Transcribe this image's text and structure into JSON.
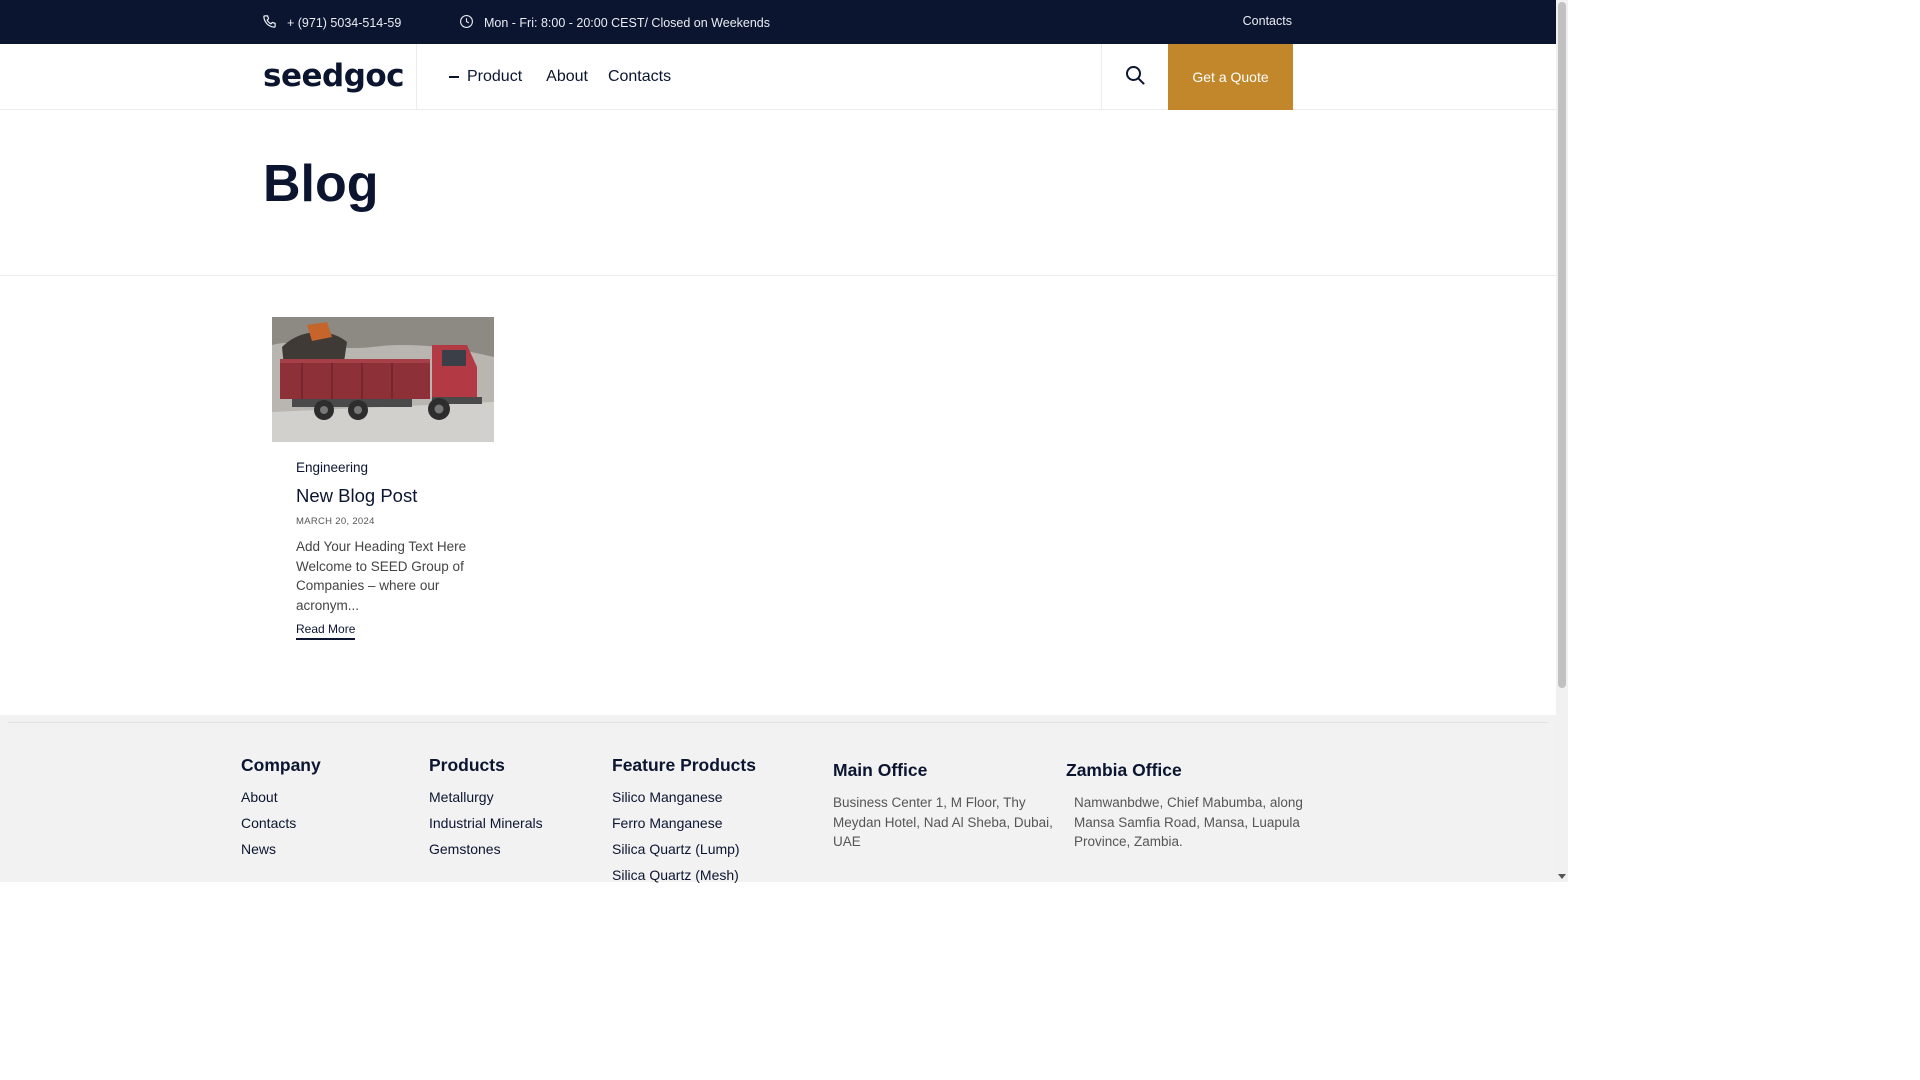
{
  "topbar": {
    "phone": "+ (971) 5034-514-59",
    "hours": "Mon - Fri: 8:00 - 20:00 CEST/ Closed on Weekends",
    "contacts": "Contacts"
  },
  "header": {
    "logo": "seedgoc",
    "nav": {
      "product": "Product",
      "about": "About",
      "contacts": "Contacts"
    },
    "quote_button": "Get a Quote"
  },
  "hero": {
    "title": "Blog"
  },
  "post": {
    "category": "Engineering",
    "title": "New Blog Post",
    "date": "MARCH 20, 2024",
    "excerpt": "Add Your Heading Text Here Welcome to SEED Group of Companies – where our acronym...",
    "read_more": "Read More"
  },
  "footer": {
    "company": {
      "title": "Company",
      "links": [
        "About",
        "Contacts",
        "News"
      ]
    },
    "products": {
      "title": "Products",
      "links": [
        "Metallurgy",
        "Industrial Minerals",
        "Gemstones"
      ]
    },
    "feature_products": {
      "title": "Feature Products",
      "links": [
        "Silico Manganese",
        "Ferro Manganese",
        "Silica Quartz (Lump)",
        "Silica Quartz (Mesh)"
      ]
    },
    "main_office": {
      "title": "Main Office",
      "address": "Business Center 1, M Floor, Thy Meydan Hotel, Nad Al Sheba, Dubai, UAE"
    },
    "zambia_office": {
      "title": "Zambia Office",
      "address": "Namwanbdwe, Chief Mabumba, along Mansa Samfia Road, Mansa, Luapula Province, Zambia."
    }
  },
  "colors": {
    "navy": "#0b1530",
    "accent": "#c2872a",
    "footer_bg": "#f2f2f2"
  },
  "icons": {
    "phone": "phone-icon",
    "clock": "clock-icon",
    "search": "search-icon"
  }
}
